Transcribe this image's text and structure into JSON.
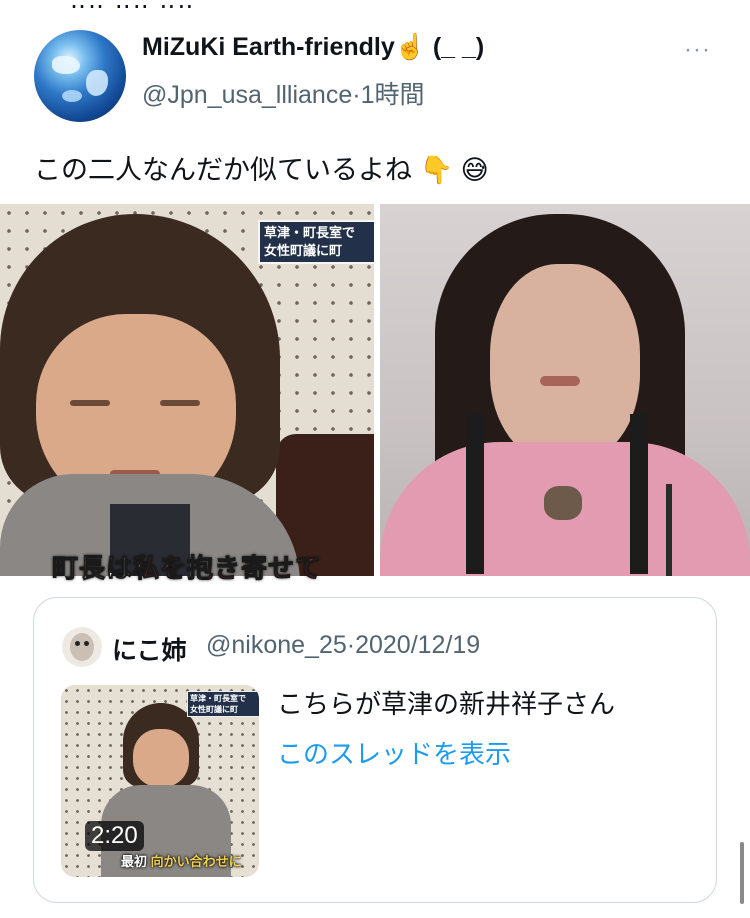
{
  "tweet": {
    "author_name": "MiZuKi Earth-friendly☝️ (_ _)",
    "handle": "@Jpn_usa_llliance",
    "separator": "·",
    "time": "1時間",
    "more_label": "···",
    "text": "この二人なんだか似ているよね 👇 😅",
    "images": {
      "left": {
        "news_tag_line1": "草津・町長室で",
        "news_tag_line2": "女性町議に町",
        "caption_white_1": "町長は",
        "caption_red": "私を抱き寄せて",
        "caption_white_2": ""
      }
    }
  },
  "quote": {
    "author_name": "にこ姉",
    "handle": "@nikone_25",
    "separator": "·",
    "date": "2020/12/19",
    "text": "こちらが草津の新井祥子さん",
    "link_text": "このスレッドを表示",
    "video": {
      "duration": "2:20",
      "tag_line1": "草津・町長室で",
      "tag_line2": "女性町議に町",
      "caption_white": "最初",
      "caption_yellow": "向かい合わせに"
    }
  },
  "colors": {
    "text_primary": "#0f1419",
    "text_secondary": "#536471",
    "link": "#1d9bf0",
    "border": "#cfd9de"
  }
}
